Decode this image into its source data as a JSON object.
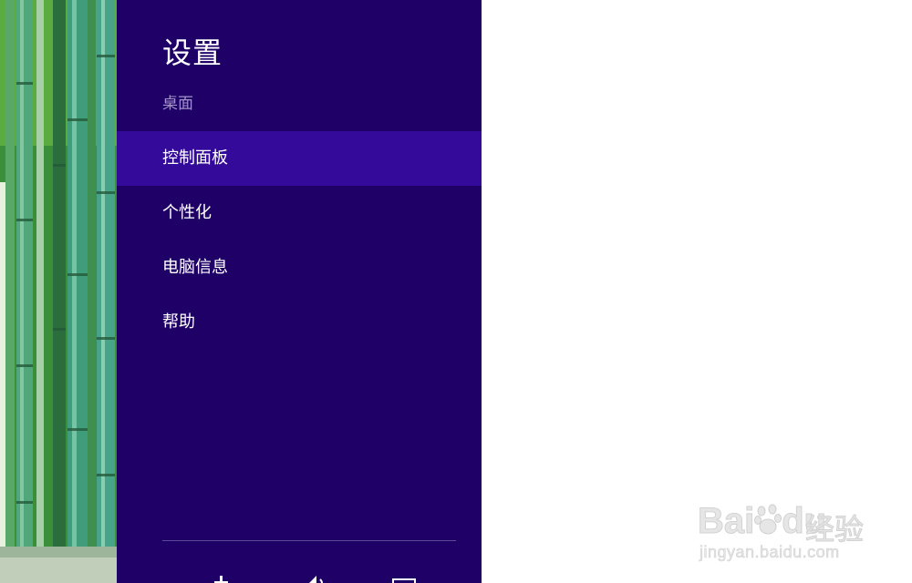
{
  "panel": {
    "title": "设置",
    "subtitle": "桌面",
    "items": [
      {
        "label": "控制面板",
        "active": true
      },
      {
        "label": "个性化",
        "active": false
      },
      {
        "label": "电脑信息",
        "active": false
      },
      {
        "label": "帮助",
        "active": false
      }
    ],
    "quick_icons": [
      "network-icon",
      "volume-icon",
      "screen-icon"
    ]
  },
  "wallpaper": {
    "subject": "bamboo"
  },
  "watermark": {
    "logo": "Bai",
    "logo_suffix": "du",
    "logo_cn": "经验",
    "url": "jingyan.baidu.com"
  },
  "colors": {
    "panel_bg": "#1e0066",
    "active_item_bg": "#330a99",
    "subtitle": "#a393c8",
    "page_bg": "#ffffff"
  }
}
